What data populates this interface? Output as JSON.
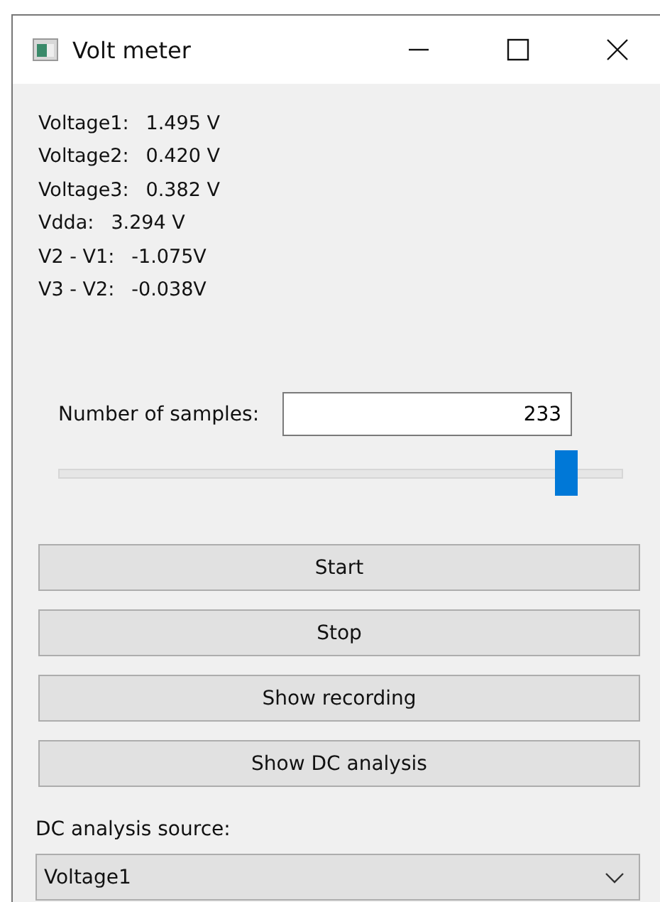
{
  "window": {
    "title": "Volt meter"
  },
  "readings": [
    {
      "label": "Voltage1:",
      "value": "1.495 V"
    },
    {
      "label": "Voltage2:",
      "value": "0.420 V"
    },
    {
      "label": "Voltage3:",
      "value": "0.382 V"
    },
    {
      "label": "Vdda:",
      "value": "3.294 V"
    },
    {
      "label": "V2 - V1:",
      "value": "-1.075V"
    },
    {
      "label": "V3 - V2:",
      "value": "-0.038V"
    }
  ],
  "samples": {
    "label": "Number of samples:",
    "value": "233",
    "level": 0.9
  },
  "buttons": [
    "Start",
    "Stop",
    "Show recording",
    "Show DC analysis"
  ],
  "dc_source": {
    "label": "DC analysis source:",
    "value": "Voltage1"
  }
}
